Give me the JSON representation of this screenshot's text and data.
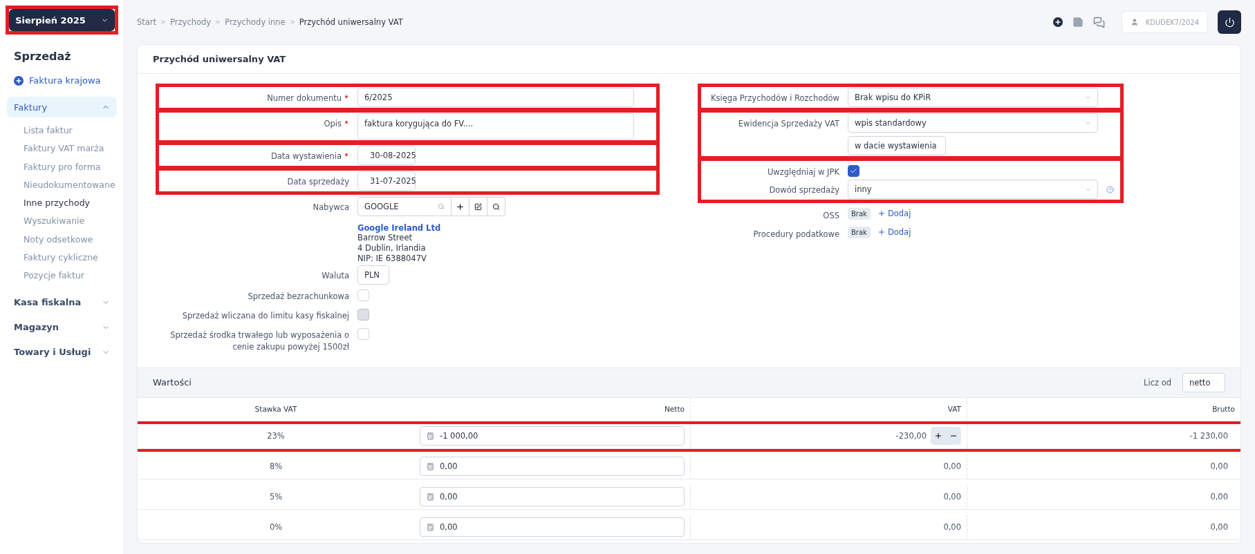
{
  "period_button": {
    "label": "Sierpień 2025",
    "highlighted": true
  },
  "sidebar": {
    "heading": "Sprzedaż",
    "action": "Faktura krajowa",
    "groups": [
      {
        "label": "Faktury",
        "expanded": true,
        "children": [
          {
            "label": "Lista faktur",
            "selected": false
          },
          {
            "label": "Faktury VAT marża",
            "selected": false
          },
          {
            "label": "Faktury pro forma",
            "selected": false
          },
          {
            "label": "Nieudokumentowane",
            "selected": false
          },
          {
            "label": "Inne przychody",
            "selected": true
          },
          {
            "label": "Wyszukiwanie",
            "selected": false
          },
          {
            "label": "Noty odsetkowe",
            "selected": false
          },
          {
            "label": "Faktury cykliczne",
            "selected": false
          },
          {
            "label": "Pozycje faktur",
            "selected": false
          }
        ]
      },
      {
        "label": "Kasa fiskalna",
        "expanded": false
      },
      {
        "label": "Magazyn",
        "expanded": false
      },
      {
        "label": "Towary i Usługi",
        "expanded": false
      }
    ]
  },
  "breadcrumb": [
    "Start",
    "Przychody",
    "Przychody inne",
    "Przychód uniwersalny VAT"
  ],
  "user": {
    "name": "KDUDEK7/2024"
  },
  "card_title": "Przychód uniwersalny VAT",
  "left_sections": [
    {
      "highlighted": true,
      "fields": [
        {
          "kind": "text",
          "label": "Numer dokumentu",
          "required": true,
          "value": "6/2025"
        }
      ]
    },
    {
      "highlighted": true,
      "fields": [
        {
          "kind": "textarea",
          "label": "Opis",
          "required": true,
          "value": "faktura korygująca do FV...."
        }
      ]
    },
    {
      "highlighted": true,
      "fields": [
        {
          "kind": "date",
          "label": "Data wystawienia",
          "required": true,
          "value": "30-08-2025"
        }
      ]
    },
    {
      "highlighted": true,
      "fields": [
        {
          "kind": "date",
          "label": "Data sprzedaży",
          "required": false,
          "value": "31-07-2025"
        }
      ]
    },
    {
      "highlighted": false,
      "fields": [
        {
          "kind": "buyer",
          "label": "Nabywca",
          "required": false,
          "value": "GOOGLE",
          "company": "Google Ireland Ltd",
          "address": [
            "Barrow Street",
            "4 Dublin, Irlandia",
            "NIP: IE 6388047V"
          ]
        },
        {
          "kind": "select",
          "label": "Waluta",
          "required": false,
          "value": "PLN"
        },
        {
          "kind": "checkbox",
          "label": "Sprzedaż bezrachunkowa",
          "required": false,
          "checked": false,
          "disabled": false
        },
        {
          "kind": "checkbox",
          "label": "Sprzedaż wliczana do limitu kasy fiskalnej",
          "required": false,
          "checked": false,
          "disabled": true
        },
        {
          "kind": "checkbox",
          "label": "Sprzedaż środka trwałego lub wyposażenia o cenie zakupu powyżej 1500zł",
          "required": false,
          "checked": false,
          "disabled": false
        }
      ]
    }
  ],
  "right_sections": [
    {
      "highlighted": true,
      "fields": [
        {
          "kind": "select",
          "label": "Księga Przychodów i Rozchodów",
          "value": "Brak wpisu do KPiR"
        }
      ]
    },
    {
      "highlighted": true,
      "fields": [
        {
          "kind": "select",
          "label": "Ewidencja Sprzedaży VAT",
          "value": "wpis standardowy",
          "value2": "w dacie wystawienia"
        }
      ]
    },
    {
      "highlighted": true,
      "fields": [
        {
          "kind": "checkbox",
          "label": "Uwzględniaj w JPK",
          "checked": true
        },
        {
          "kind": "select",
          "label": "Dowód sprzedaży",
          "value": "inny",
          "help": true
        }
      ]
    },
    {
      "highlighted": false,
      "fields": [
        {
          "kind": "tags",
          "label": "OSS",
          "badge": "Brak",
          "link": "Dodaj"
        },
        {
          "kind": "tags",
          "label": "Procedury podatkowe",
          "badge": "Brak",
          "link": "Dodaj"
        }
      ]
    }
  ],
  "values": {
    "title": "Wartości",
    "calc_label": "Licz od",
    "calc_value": "netto",
    "columns": [
      "Stawka VAT",
      "Netto",
      "VAT",
      "Brutto"
    ],
    "rows": [
      {
        "rate": "23%",
        "netto": "-1 000,00",
        "vat": "-230,00",
        "brutto": "-1 230,00",
        "stepper": true,
        "highlighted": true
      },
      {
        "rate": "8%",
        "netto": "0,00",
        "vat": "0,00",
        "brutto": "0,00",
        "stepper": false,
        "highlighted": false
      },
      {
        "rate": "5%",
        "netto": "0,00",
        "vat": "0,00",
        "brutto": "0,00",
        "stepper": false,
        "highlighted": false
      },
      {
        "rate": "0%",
        "netto": "0,00",
        "vat": "0,00",
        "brutto": "0,00",
        "stepper": false,
        "highlighted": false
      }
    ]
  }
}
